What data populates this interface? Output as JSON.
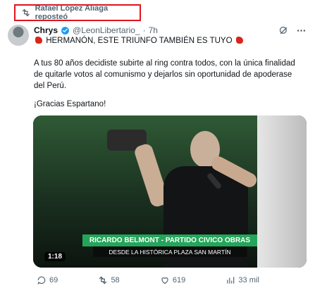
{
  "repost": {
    "label": "Rafael López Aliaga reposteó"
  },
  "tweet": {
    "name": "Chrys",
    "handle": "@LeonLibertario_",
    "dot": "·",
    "time": "7h",
    "headline": "HERMANÓN, ESTE TRIUNFO TAMBIÉN ES TUYO",
    "body": "A tus 80 años decidiste subirte al ring contra todos, con la única finalidad de quitarle votos al comunismo y dejarlos sin oportunidad de apoderase del Perú.",
    "body2": "¡Gracias Espartano!"
  },
  "media": {
    "duration": "1:18",
    "banner_line1": "RICARDO BELMONT - PARTIDO CIVICO OBRAS",
    "banner_line2": "DESDE LA HISTÓRICA PLAZA SAN MARTÍN"
  },
  "actions": {
    "reply": "69",
    "retweet": "58",
    "like": "619",
    "views": "33 mil"
  },
  "colors": {
    "accent": "#1d9bf0",
    "red_box": "#e0141e",
    "banner_green": "#24a65a"
  },
  "icons": [
    "repost-icon",
    "verified-icon",
    "grok-icon",
    "more-icon",
    "reply-icon",
    "retweet-icon",
    "like-icon",
    "views-icon",
    "bookmark-icon",
    "share-icon",
    "boxing-glove-icon"
  ]
}
